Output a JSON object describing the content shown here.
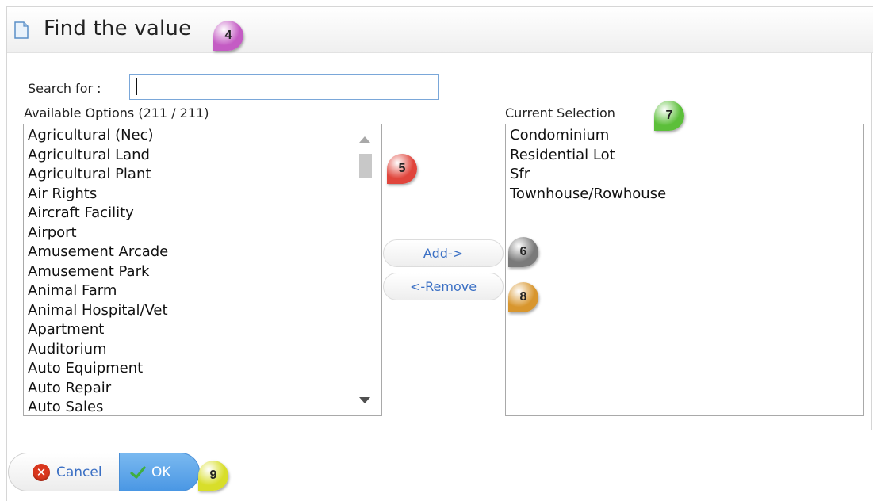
{
  "dialog": {
    "title": "Find the value",
    "title_icon": "document-icon"
  },
  "search": {
    "label": "Search for :",
    "value": "",
    "placeholder": ""
  },
  "available": {
    "label": "Available Options (211 / 211)",
    "items": [
      "Agricultural (Nec)",
      "Agricultural Land",
      "Agricultural Plant",
      "Air Rights",
      "Aircraft Facility",
      "Airport",
      "Amusement Arcade",
      "Amusement Park",
      "Animal Farm",
      "Animal Hospital/Vet",
      "Apartment",
      "Auditorium",
      "Auto Equipment",
      "Auto Repair",
      "Auto Sales"
    ]
  },
  "current": {
    "label": "Current Selection",
    "items": [
      "Condominium",
      "Residential Lot",
      "Sfr",
      "Townhouse/Rowhouse"
    ]
  },
  "buttons": {
    "add": "Add->",
    "remove": "<-Remove",
    "cancel": "Cancel",
    "ok": "OK"
  },
  "callouts": [
    {
      "label": "4",
      "color": "#c45cc4"
    },
    {
      "label": "5",
      "color": "#e0453c"
    },
    {
      "label": "6",
      "color": "#7a7a7a"
    },
    {
      "label": "7",
      "color": "#5cbf3a"
    },
    {
      "label": "8",
      "color": "#d8962e"
    },
    {
      "label": "9",
      "color": "#d8de2a"
    }
  ],
  "colors": {
    "accent_blue": "#4a97e4",
    "link_blue": "#3a6fc4",
    "cancel_red": "#d9361d"
  }
}
